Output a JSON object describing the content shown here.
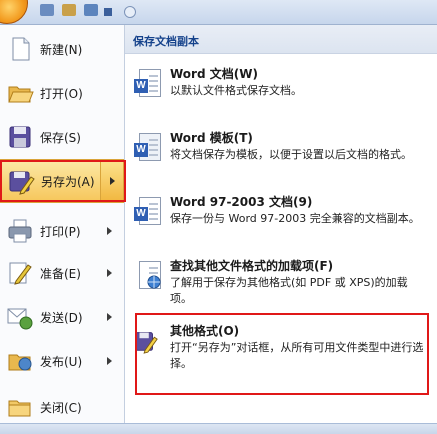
{
  "left_menu": {
    "items": [
      {
        "label": "新建(N)",
        "icon": "new-document-icon"
      },
      {
        "label": "打开(O)",
        "icon": "open-folder-icon"
      },
      {
        "label": "保存(S)",
        "icon": "save-disk-icon"
      },
      {
        "label": "另存为(A)",
        "icon": "save-as-icon",
        "active": true
      },
      {
        "label": "打印(P)",
        "icon": "printer-icon"
      },
      {
        "label": "准备(E)",
        "icon": "prepare-pen-icon"
      },
      {
        "label": "发送(D)",
        "icon": "send-icon"
      },
      {
        "label": "发布(U)",
        "icon": "publish-icon"
      },
      {
        "label": "关闭(C)",
        "icon": "close-folder-icon"
      }
    ]
  },
  "right_pane": {
    "header": "保存文档副本",
    "entries": [
      {
        "title": "Word 文档(W)",
        "desc": "以默认文件格式保存文档。",
        "icon": "word-document-icon"
      },
      {
        "title": "Word 模板(T)",
        "desc": "将文档保存为模板，以便于设置以后文档的格式。",
        "icon": "word-template-icon"
      },
      {
        "title": "Word 97-2003 文档(9)",
        "desc": "保存一份与 Word 97-2003 完全兼容的文档副本。",
        "icon": "word-97-document-icon"
      },
      {
        "title": "查找其他文件格式的加载项(F)",
        "desc": "了解用于保存为其他格式(如 PDF 或 XPS)的加载项。",
        "icon": "add-in-search-icon"
      },
      {
        "title": "其他格式(O)",
        "desc": "打开“另存为”对话框，从所有可用文件类型中进行选择。",
        "icon": "other-formats-icon"
      }
    ]
  },
  "colors": {
    "highlight": "#e01818",
    "active_bg": "#f6c65a"
  }
}
